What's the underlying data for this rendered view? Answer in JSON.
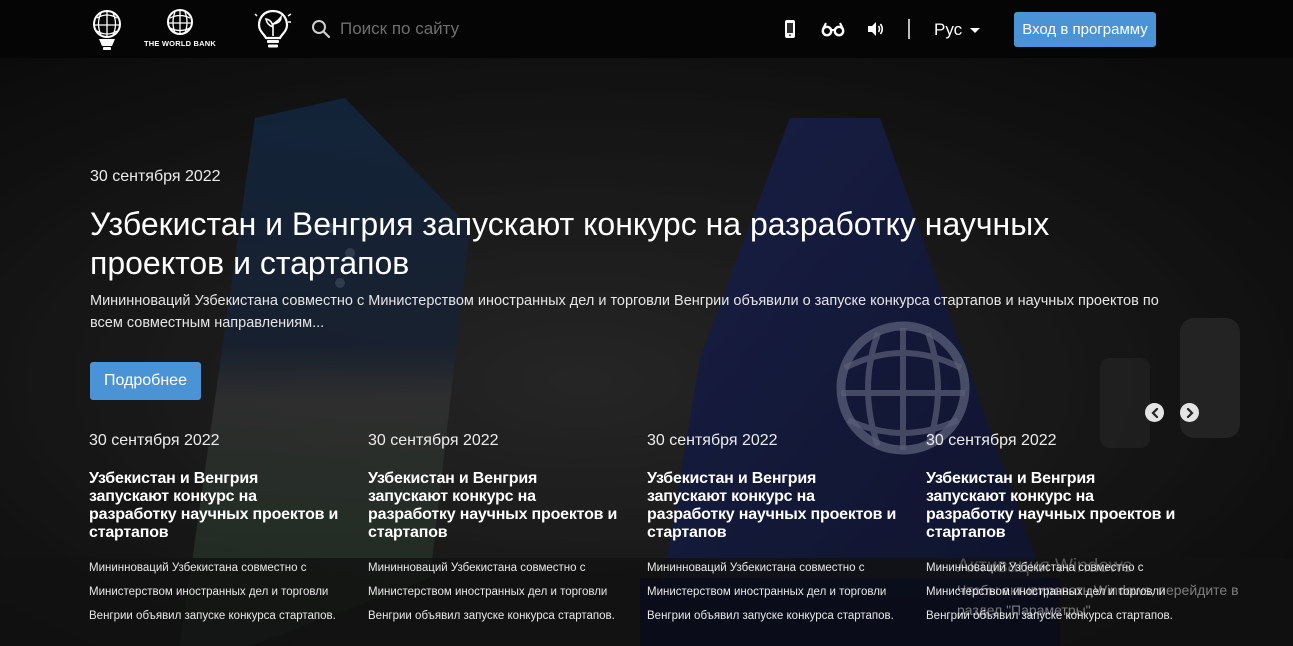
{
  "header": {
    "logo_wb_text": "THE WORLD BANK",
    "search_placeholder": "Поиск по сайту",
    "language": "Рус",
    "login_label": "Вход в программу",
    "icons": [
      "ministry-logo-icon",
      "world-bank-logo-icon",
      "bulb-logo-icon",
      "search-icon",
      "mobile-icon",
      "glasses-icon",
      "speaker-icon",
      "caret-down-icon"
    ]
  },
  "hero": {
    "date": "30 сентября 2022",
    "title": "Узбекистан и Венгрия запускают конкурс на разработку научных проектов и стартапов",
    "description": "Мининноваций Узбекистана совместно с Министерством иностранных дел и торговли Венгрии объявили о запуске конкурса стартапов и научных проектов по всем совместным направлениям...",
    "button_label": "Подробнее",
    "button_color": "#4a94d6"
  },
  "news": [
    {
      "date": "30 сентября 2022",
      "title": "Узбекистан и Венгрия запускают конкурс на разработку научных проектов и стартапов",
      "text": "Мининноваций Узбекистана совместно с Министерством иностранных дел и торговли Венгрии объявил запуске конкурса стартапов."
    },
    {
      "date": "30 сентября 2022",
      "title": "Узбекистан и Венгрия запускают конкурс на разработку научных проектов и стартапов",
      "text": "Мининноваций Узбекистана совместно с Министерством иностранных дел и торговли Венгрии объявил запуске конкурса стартапов."
    },
    {
      "date": "30 сентября 2022",
      "title": "Узбекистан и Венгрия запускают конкурс на разработку научных проектов и стартапов",
      "text": "Мининноваций Узбекистана совместно с Министерством иностранных дел и торговли Венгрии объявил запуске конкурса стартапов."
    },
    {
      "date": "30 сентября 2022",
      "title": "Узбекистан и Венгрия запускают конкурс на разработку научных проектов и стартапов",
      "text": "Мининноваций Узбекистана совместно с Министерством иностранных дел и торговли Венгрии объявил запуске конкурса стартапов."
    }
  ],
  "watermark": {
    "title": "Активация Windows",
    "subtitle": "Чтобы активировать Windows, перейдите в раздел \"Параметры\"."
  }
}
